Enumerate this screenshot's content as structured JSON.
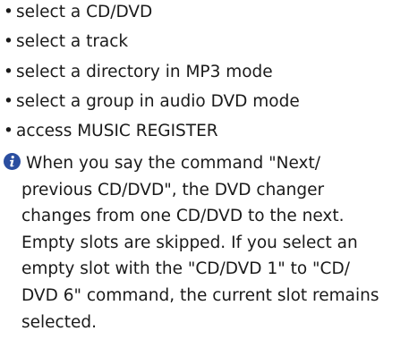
{
  "bullets": [
    "select a CD/DVD",
    "select a track",
    "select a directory in MP3 mode",
    "select a group in audio DVD mode",
    "access MUSIC REGISTER"
  ],
  "bullet_char": "•",
  "note": {
    "icon": "info-icon",
    "icon_color": "#2a4ea0",
    "lines": [
      "When you say the command \"Next/",
      "previous CD/DVD\", the DVD changer",
      "changes from one CD/DVD to the next.",
      "Empty slots are skipped. If you select an",
      "empty slot with the \"CD/DVD 1\" to \"CD/",
      "DVD 6\" command, the current slot remains",
      "selected."
    ]
  }
}
